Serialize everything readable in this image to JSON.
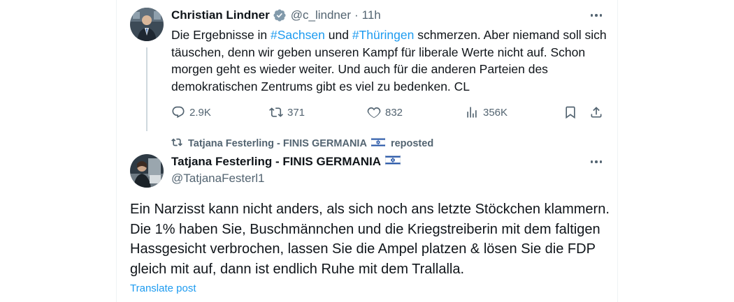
{
  "tweet1": {
    "author_name": "Christian Lindner",
    "handle": "@c_lindner",
    "separator": "·",
    "time": "11h",
    "text_parts": {
      "p1": "Die Ergebnisse in ",
      "tag1": "#Sachsen",
      "p2": " und ",
      "tag2": "#Thüringen",
      "p3": " schmerzen. Aber niemand soll sich täuschen, denn wir geben unseren Kampf für liberale Werte nicht auf. Schon morgen geht es wieder weiter. Und auch für die anderen Parteien des demokratischen Zentrums gibt es viel zu bedenken. CL"
    },
    "stats": {
      "replies": "2.9K",
      "reposts": "371",
      "likes": "832",
      "views": "356K"
    }
  },
  "repost": {
    "label_name": "Tatjana Festerling - FINIS GERMANIA",
    "label_suffix": "reposted"
  },
  "tweet2": {
    "author_name": "Tatjana Festerling - FINIS GERMANIA",
    "handle": "@TatjanaFesterl1",
    "text": "Ein Narzisst kann nicht anders, als sich noch ans letzte Stöckchen klammern. Die 1% haben Sie, Buschmännchen und die Kriegstreiberin mit dem faltigen Hassgesicht verbrochen, lassen Sie die Ampel platzen & lösen Sie die FDP gleich mit auf, dann ist endlich Ruhe mit dem Trallalla.",
    "translate_label": "Translate post"
  },
  "icons": {
    "verified": "verified-badge-icon",
    "more": "more-icon",
    "reply": "reply-icon",
    "repost": "repost-icon",
    "like": "like-icon",
    "views": "views-icon",
    "bookmark": "bookmark-icon",
    "share": "share-icon",
    "flag": "israel-flag-icon"
  },
  "colors": {
    "link": "#1d9bf0",
    "secondary": "#536471",
    "text": "#0f1419",
    "thread_line": "#cfd9de"
  }
}
